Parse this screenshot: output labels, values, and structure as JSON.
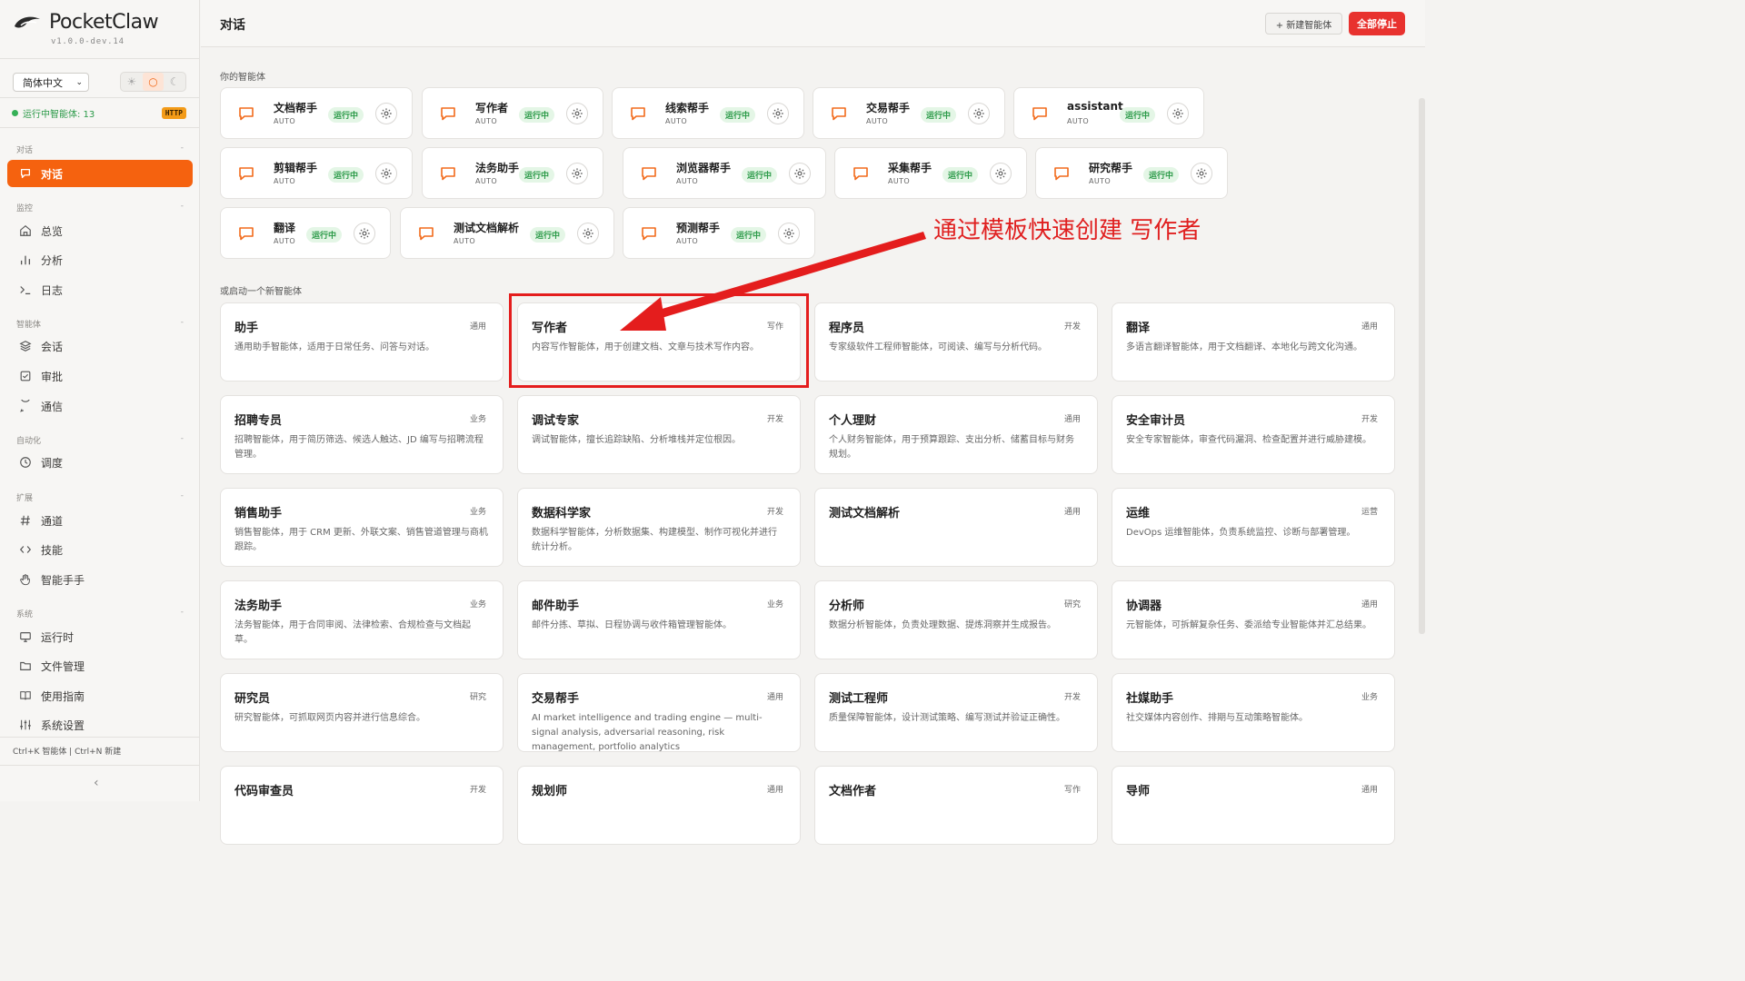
{
  "app": {
    "name_light": "Pocket",
    "name_bold": "Claw",
    "version": "v1.0.0-dev.14"
  },
  "sidebar": {
    "language": "简体中文",
    "theme": [
      "☀",
      "○",
      "☾"
    ],
    "running_label": "运行中智能体: 13",
    "http_badge": "HTTP",
    "sections": [
      {
        "label": "对话",
        "items": [
          {
            "label": "对话",
            "icon": "chat-icon",
            "active": true
          }
        ]
      },
      {
        "label": "监控",
        "items": [
          {
            "label": "总览",
            "icon": "home-icon"
          },
          {
            "label": "分析",
            "icon": "bar-chart-icon"
          },
          {
            "label": "日志",
            "icon": "terminal-icon"
          }
        ]
      },
      {
        "label": "智能体",
        "items": [
          {
            "label": "会话",
            "icon": "layers-icon"
          },
          {
            "label": "审批",
            "icon": "check-square-icon"
          },
          {
            "label": "通信",
            "icon": "message-icon"
          }
        ]
      },
      {
        "label": "自动化",
        "items": [
          {
            "label": "调度",
            "icon": "clock-icon"
          }
        ]
      },
      {
        "label": "扩展",
        "items": [
          {
            "label": "通道",
            "icon": "hash-icon"
          },
          {
            "label": "技能",
            "icon": "code-icon"
          },
          {
            "label": "智能手手",
            "icon": "hand-icon"
          }
        ]
      },
      {
        "label": "系统",
        "items": [
          {
            "label": "运行时",
            "icon": "monitor-icon"
          },
          {
            "label": "文件管理",
            "icon": "folder-icon"
          },
          {
            "label": "使用指南",
            "icon": "book-icon"
          },
          {
            "label": "系统设置",
            "icon": "sliders-icon"
          }
        ]
      }
    ],
    "shortcut": "Ctrl+K 智能体 | Ctrl+N 新建",
    "collapse": "‹"
  },
  "header": {
    "title": "对话",
    "new_agent": "+ 新建智能体",
    "stop_all": "全部停止"
  },
  "main": {
    "your_agents_label": "你的智能体",
    "status_label": "运行中",
    "auto_label": "AUTO",
    "agents": [
      {
        "name": "文档帮手"
      },
      {
        "name": "写作者"
      },
      {
        "name": "线索帮手"
      },
      {
        "name": "交易帮手"
      },
      {
        "name": "assistant"
      },
      {
        "name": "剪辑帮手"
      },
      {
        "name": "法务助手"
      },
      {
        "name": "浏览器帮手"
      },
      {
        "name": "采集帮手"
      },
      {
        "name": "研究帮手"
      },
      {
        "name": "翻译"
      },
      {
        "name": "测试文档解析"
      },
      {
        "name": "预测帮手"
      }
    ],
    "new_agent_label": "或启动一个新智能体",
    "templates": [
      {
        "name": "助手",
        "tag": "通用",
        "desc": "通用助手智能体，适用于日常任务、问答与对话。"
      },
      {
        "name": "写作者",
        "tag": "写作",
        "desc": "内容写作智能体，用于创建文档、文章与技术写作内容。"
      },
      {
        "name": "程序员",
        "tag": "开发",
        "desc": "专家级软件工程师智能体，可阅读、编写与分析代码。"
      },
      {
        "name": "翻译",
        "tag": "通用",
        "desc": "多语言翻译智能体，用于文档翻译、本地化与跨文化沟通。"
      },
      {
        "name": "招聘专员",
        "tag": "业务",
        "desc": "招聘智能体，用于简历筛选、候选人触达、JD 编写与招聘流程管理。"
      },
      {
        "name": "调试专家",
        "tag": "开发",
        "desc": "调试智能体，擅长追踪缺陷、分析堆栈并定位根因。"
      },
      {
        "name": "个人理财",
        "tag": "通用",
        "desc": "个人财务智能体，用于预算跟踪、支出分析、储蓄目标与财务规划。"
      },
      {
        "name": "安全审计员",
        "tag": "开发",
        "desc": "安全专家智能体，审查代码漏洞、检查配置并进行威胁建模。"
      },
      {
        "name": "销售助手",
        "tag": "业务",
        "desc": "销售智能体，用于 CRM 更新、外联文案、销售管道管理与商机跟踪。"
      },
      {
        "name": "数据科学家",
        "tag": "开发",
        "desc": "数据科学智能体，分析数据集、构建模型、制作可视化并进行统计分析。"
      },
      {
        "name": "测试文档解析",
        "tag": "通用",
        "desc": ""
      },
      {
        "name": "运维",
        "tag": "运营",
        "desc": "DevOps 运维智能体，负责系统监控、诊断与部署管理。"
      },
      {
        "name": "法务助手",
        "tag": "业务",
        "desc": "法务智能体，用于合同审阅、法律检索、合规检查与文档起草。"
      },
      {
        "name": "邮件助手",
        "tag": "业务",
        "desc": "邮件分拣、草拟、日程协调与收件箱管理智能体。"
      },
      {
        "name": "分析师",
        "tag": "研究",
        "desc": "数据分析智能体，负责处理数据、提炼洞察并生成报告。"
      },
      {
        "name": "协调器",
        "tag": "通用",
        "desc": "元智能体，可拆解复杂任务、委派给专业智能体并汇总结果。"
      },
      {
        "name": "研究员",
        "tag": "研究",
        "desc": "研究智能体，可抓取网页内容并进行信息综合。"
      },
      {
        "name": "交易帮手",
        "tag": "通用",
        "desc": "AI market intelligence and trading engine — multi-signal analysis, adversarial reasoning, risk management, portfolio analytics"
      },
      {
        "name": "测试工程师",
        "tag": "开发",
        "desc": "质量保障智能体，设计测试策略、编写测试并验证正确性。"
      },
      {
        "name": "社媒助手",
        "tag": "业务",
        "desc": "社交媒体内容创作、排期与互动策略智能体。"
      },
      {
        "name": "代码审查员",
        "tag": "开发",
        "desc": ""
      },
      {
        "name": "规划师",
        "tag": "通用",
        "desc": ""
      },
      {
        "name": "文档作者",
        "tag": "写作",
        "desc": ""
      },
      {
        "name": "导师",
        "tag": "通用",
        "desc": ""
      }
    ]
  },
  "annotation": {
    "text": "通过模板快速创建 写作者",
    "color": "#e02020"
  },
  "colors": {
    "accent": "#f5620f",
    "running": "#2b9a48",
    "danger": "#e8322e"
  }
}
